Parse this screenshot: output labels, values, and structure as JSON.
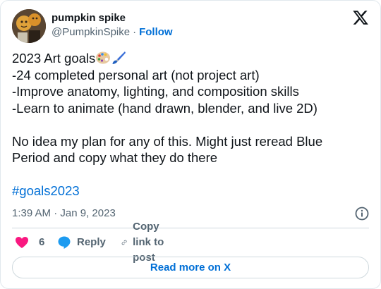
{
  "author": {
    "display_name": "pumpkin spike",
    "handle": "@PumpkinSpike",
    "separator": "·",
    "follow_label": "Follow"
  },
  "post": {
    "lines": [
      "2023 Art goals",
      "-24 completed personal art (not project art)",
      "-Improve anatomy, lighting, and composition skills",
      "-Learn to animate (hand drawn, blender, and live 2D)",
      "No idea my plan for any of this. Might just reread Blue",
      "Period and copy what they do there"
    ],
    "hashtag": "#goals2023",
    "emojis": [
      "artist-palette-icon",
      "paintbrush-icon"
    ]
  },
  "meta": {
    "time": "1:39 AM",
    "separator": "·",
    "date": "Jan 9, 2023"
  },
  "actions": {
    "like_count": "6",
    "reply_label": "Reply",
    "copy_label": "Copy link to post"
  },
  "read_more_label": "Read more on X",
  "colors": {
    "link": "#006fd6",
    "heart": "#f91880",
    "reply_bubble": "#1d9bf0",
    "secondary_text": "#536471"
  }
}
